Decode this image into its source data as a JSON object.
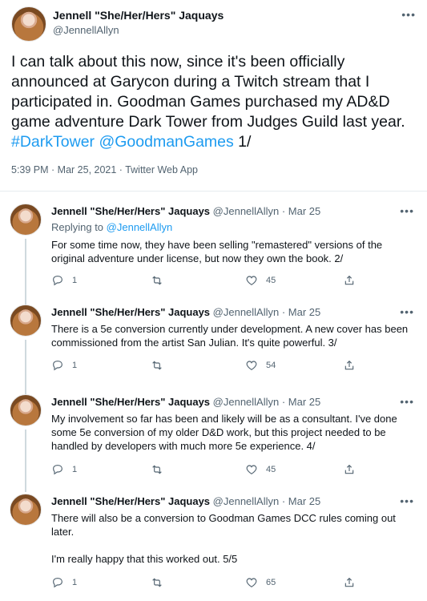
{
  "main_tweet": {
    "author_name": "Jennell \"She/Her/Hers\" Jaquays",
    "author_handle": "@JennellAllyn",
    "text_part1": "I can talk about this now, since it's been officially announced at Garycon during a Twitch stream that I participated in. Goodman Games purchased my AD&D game adventure Dark Tower from Judges Guild last year. ",
    "hashtag": "#DarkTower",
    "mention": "@GoodmanGames",
    "text_suffix": "  1/",
    "meta": "5:39 PM · Mar 25, 2021 · Twitter Web App",
    "more_icon": "more-dots-icon"
  },
  "replies": [
    {
      "author_name": "Jennell \"She/Her/Hers\" Jaquays",
      "author_handle": "@JennellAllyn",
      "date": "Mar 25",
      "replying_to_prefix": "Replying to ",
      "replying_to_handle": "@JennellAllyn",
      "text": "For some time now, they have been selling \"remastered\" versions of the original adventure under license, but now they own the book. 2/",
      "reply_count": "1",
      "retweet_count": "",
      "like_count": "45"
    },
    {
      "author_name": "Jennell \"She/Her/Hers\" Jaquays",
      "author_handle": "@JennellAllyn",
      "date": "Mar 25",
      "text": "There is a 5e conversion currently under development. A new cover has been commissioned from the artist San Julian. It's quite powerful.  3/",
      "reply_count": "1",
      "retweet_count": "",
      "like_count": "54"
    },
    {
      "author_name": "Jennell \"She/Her/Hers\" Jaquays",
      "author_handle": "@JennellAllyn",
      "date": "Mar 25",
      "text": "My involvement so far has been and likely will be as a consultant. I've done some 5e conversion of my older D&D work, but this project needed to be handled by developers with much more 5e experience. 4/",
      "reply_count": "1",
      "retweet_count": "",
      "like_count": "45"
    },
    {
      "author_name": "Jennell \"She/Her/Hers\" Jaquays",
      "author_handle": "@JennellAllyn",
      "date": "Mar 25",
      "text": "There will also be a conversion to Goodman Games DCC rules coming out later.\n\nI'm really happy that this worked out. 5/5",
      "reply_count": "1",
      "retweet_count": "",
      "like_count": "65"
    }
  ],
  "separator": " · ",
  "colors": {
    "link": "#1d9bf0",
    "secondary": "#536471",
    "text": "#0f1419",
    "divider": "#e6ecf0"
  }
}
